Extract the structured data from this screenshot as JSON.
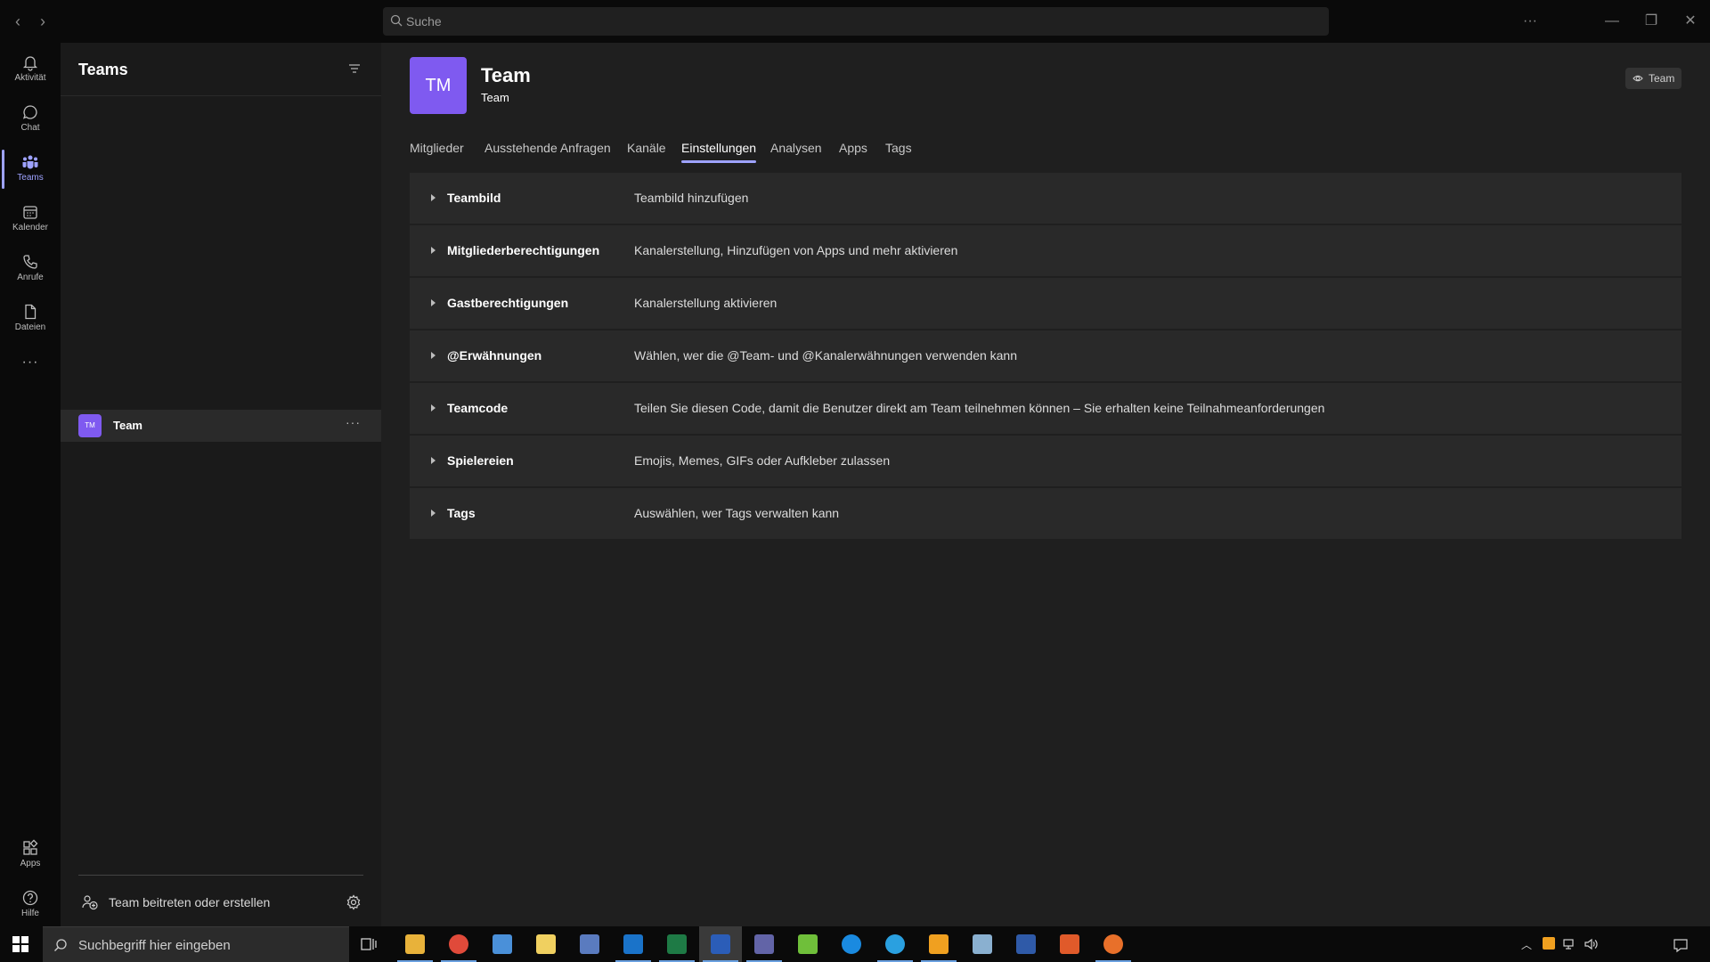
{
  "titlebar": {
    "search_placeholder": "Suche",
    "more": "···",
    "minimize": "—",
    "restore": "❐",
    "close": "✕"
  },
  "rail": {
    "items": [
      {
        "label": "Aktivität",
        "icon": "bell-icon"
      },
      {
        "label": "Chat",
        "icon": "chat-icon"
      },
      {
        "label": "Teams",
        "icon": "teams-icon",
        "active": true
      },
      {
        "label": "Kalender",
        "icon": "calendar-icon"
      },
      {
        "label": "Anrufe",
        "icon": "phone-icon"
      },
      {
        "label": "Dateien",
        "icon": "file-icon"
      }
    ],
    "more": "···",
    "apps_label": "Apps",
    "help_label": "Hilfe"
  },
  "panel": {
    "title": "Teams",
    "team": {
      "initials": "TM",
      "name": "Team",
      "more": "···"
    },
    "join_label": "Team beitreten oder erstellen"
  },
  "main": {
    "team_initials": "TM",
    "team_title": "Team",
    "team_subtitle": "Team",
    "pill_label": "Team",
    "tabs": [
      {
        "label": "Mitglieder"
      },
      {
        "label": "Ausstehende Anfragen"
      },
      {
        "label": "Kanäle"
      },
      {
        "label": "Einstellungen",
        "active": true
      },
      {
        "label": "Analysen"
      },
      {
        "label": "Apps"
      },
      {
        "label": "Tags"
      }
    ],
    "settings": [
      {
        "title": "Teambild",
        "desc": "Teambild hinzufügen"
      },
      {
        "title": "Mitgliederberechtigungen",
        "desc": "Kanalerstellung, Hinzufügen von Apps und mehr aktivieren"
      },
      {
        "title": "Gastberechtigungen",
        "desc": "Kanalerstellung aktivieren"
      },
      {
        "title": "@Erwähnungen",
        "desc": "Wählen, wer die @Team- und @Kanalerwähnungen verwenden kann"
      },
      {
        "title": "Teamcode",
        "desc": "Teilen Sie diesen Code, damit die Benutzer direkt am Team teilnehmen können – Sie erhalten keine Teilnahmeanforderungen"
      },
      {
        "title": "Spielereien",
        "desc": "Emojis, Memes, GIFs oder Aufkleber zulassen"
      },
      {
        "title": "Tags",
        "desc": "Auswählen, wer Tags verwalten kann"
      }
    ]
  },
  "taskbar": {
    "search_placeholder": "Suchbegriff hier eingeben",
    "apps": [
      {
        "name": "file-explorer",
        "color": "#e8b23a"
      },
      {
        "name": "chrome",
        "color": "#e04a3a"
      },
      {
        "name": "app-3",
        "color": "#4a90d9"
      },
      {
        "name": "notepad",
        "color": "#f0d060"
      },
      {
        "name": "app-5",
        "color": "#5a7bbf"
      },
      {
        "name": "outlook",
        "color": "#1a73c9"
      },
      {
        "name": "excel",
        "color": "#1e7a45"
      },
      {
        "name": "word",
        "color": "#2b5db8"
      },
      {
        "name": "teams",
        "color": "#6264a7"
      },
      {
        "name": "app-10",
        "color": "#6fbf3a"
      },
      {
        "name": "teamviewer",
        "color": "#1a8ae0"
      },
      {
        "name": "app-12",
        "color": "#2aa0e0"
      },
      {
        "name": "app-13",
        "color": "#f0a020"
      },
      {
        "name": "app-14",
        "color": "#8ab0d0"
      },
      {
        "name": "powershell",
        "color": "#2f5aa8"
      },
      {
        "name": "app-16",
        "color": "#e05a2a"
      },
      {
        "name": "firefox",
        "color": "#e8702a"
      }
    ]
  }
}
